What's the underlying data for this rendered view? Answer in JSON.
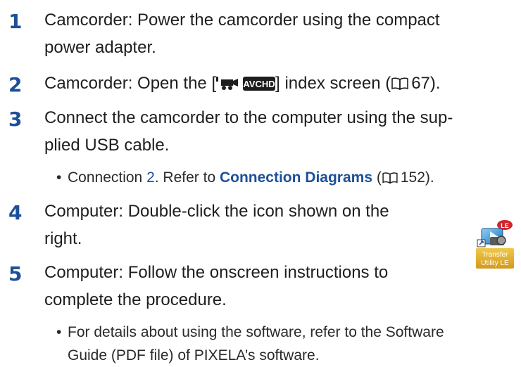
{
  "steps": [
    {
      "number": "1",
      "lines": [
        "Camcorder: Power the camcorder using the compact",
        "power adapter."
      ]
    },
    {
      "number": "2",
      "text_before": "Camcorder: Open the [",
      "text_mid": "] index screen (",
      "page_ref": "67",
      "text_after": ")."
    },
    {
      "number": "3",
      "lines": [
        "Connect the camcorder to the computer using the sup-",
        "plied USB cable."
      ],
      "bullet": {
        "prefix": "Connection ",
        "conn_number": "2",
        "middle": ". Refer to ",
        "link": "Connection Diagrams",
        "paren_open": " (",
        "page_ref": "152",
        "paren_close": ")."
      }
    },
    {
      "number": "4",
      "lines": [
        "Computer: Double-click the icon shown on the",
        "right."
      ]
    },
    {
      "number": "5",
      "lines": [
        "Computer: Follow the onscreen instructions to",
        "complete the procedure."
      ],
      "bullet": {
        "lines": [
          "For details about using the software, refer to the Software",
          "Guide (PDF file) of PIXELA’s software."
        ]
      }
    }
  ],
  "icons": {
    "index_mode": "movie-camera-icon",
    "avchd_badge": "AVCHD",
    "page_ref": "book-icon"
  },
  "app_icon": {
    "badge": "LE",
    "label_lines": [
      "Transfer",
      "Utility LE"
    ]
  },
  "colors": {
    "accent": "#1d4f9a",
    "text": "#1e1e1e"
  }
}
